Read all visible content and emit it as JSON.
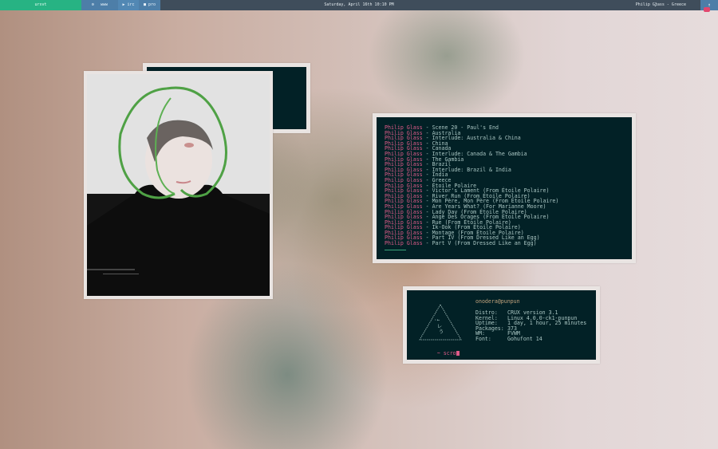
{
  "topbar": {
    "workspace": "urxvt",
    "workspaces": [
      "www",
      "irc",
      "pro"
    ],
    "clock": "Saturday, April 16th 10:10 PM",
    "music": "Philip Glass - Greece",
    "note_glyph": "♪",
    "corner_glyph": "↑",
    "colors": {
      "bar": "#3f4d5b",
      "active": "#27b383",
      "ws": "#4d7ea8",
      "badge": "#e2476e"
    }
  },
  "playlist": {
    "artist": "Philip Glass",
    "separator": " - ",
    "tracks": [
      "Scene 20 - Paul's End",
      "Australia",
      "Interlude: Australia & China",
      "China",
      "Canada",
      "Interlude: Canada & The Gambia",
      "The Gambia",
      "Brazil",
      "Interlude: Brazil & India",
      "India",
      "Greece",
      "Étoile Polaire",
      "Victor's Lament (From Étoile Polaire)",
      "River Run (From Étoile Polaire)",
      "Mon Père, Mon Père (From Étoile Polaire)",
      "Are Years What? (For Marianne Moore)",
      "Lady Day (From Étoile Polaire)",
      "Ange Des Orages (From Étoile Polaire)",
      "Rue (From Étoile Polaire)",
      "Ik-Ook (From Étoile Polaire)",
      "Montage (From Étoile Polaire)",
      "Part IV (From Dressed Like an Egg)",
      "Part V (From Dressed Like an Egg)"
    ],
    "progress": 0.09
  },
  "fetch": {
    "user_host": "onodera@punpun",
    "rows": [
      {
        "key": "Distro:",
        "value": "CRUX version 3.1"
      },
      {
        "key": "Kernel:",
        "value": "Linux 4.0.0-ck1-punpun"
      },
      {
        "key": "Uptime:",
        "value": "1 day, 1 hour, 25 minutes"
      },
      {
        "key": "Packages:",
        "value": "373"
      },
      {
        "key": "WM:",
        "value": "FVWM"
      },
      {
        "key": "Font:",
        "value": "Gohufont 14"
      }
    ],
    "prompt": "~ scro"
  },
  "colors": {
    "term_bg": "#022126",
    "fg": "#a9c5c2",
    "pink": "#e05b89",
    "accent": "#c0a27c",
    "frame": "#e9e4e2"
  }
}
